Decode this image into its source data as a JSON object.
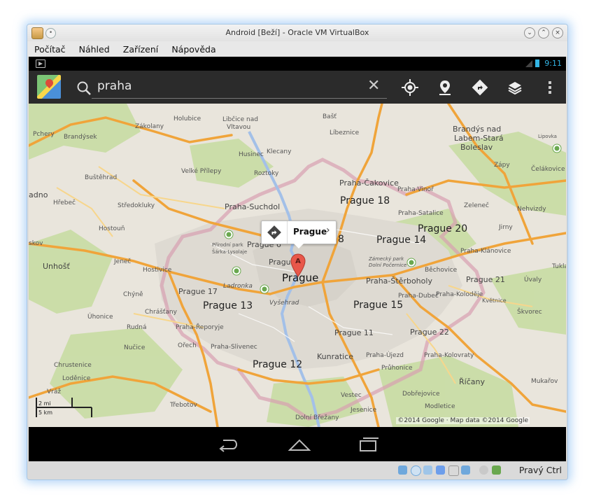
{
  "window": {
    "title": "Android [Beží] - Oracle VM VirtualBox",
    "menu": [
      "Počítač",
      "Náhled",
      "Zařízení",
      "Nápověda"
    ]
  },
  "android": {
    "status_time": "9:11",
    "search": {
      "value": "praha"
    }
  },
  "map": {
    "popup_title": "Prague",
    "marker_letter": "A",
    "scale_mi": "2 mi",
    "scale_km": "5 km",
    "copyright": "©2014 Google · Map data ©2014 Google",
    "labels": {
      "pchery": "Pchery",
      "brandysek": "Brandýsek",
      "zakolany": "Zákolany",
      "holubice": "Holubice",
      "libcice": "Libčice nad",
      "vltavou": "Vltavou",
      "basť": "Bašť",
      "libeznice": "Líbeznice",
      "brandys1": "Brandýs nad",
      "brandys2": "Labem-Stará",
      "brandys3": "Boleslav",
      "lipovka": "Lipovka",
      "husinec": "Husinec",
      "klecany": "Klecany",
      "zapy": "Zápy",
      "celakovice": "Čelákovice",
      "velke": "Velké Přílepy",
      "roztoky": "Roztoky",
      "bustehrad": "Buštěhrad",
      "cakovice": "Praha-Čakovice",
      "vinor": "Praha-Vinoř",
      "kladno": "adno",
      "hrebec": "Hřebeč",
      "stredokluky": "Středokluky",
      "suchdol": "Praha-Suchdol",
      "p18": "Prague 18",
      "satalice": "Praha-Satalice",
      "zelenec": "Zeleneč",
      "nehvizdy": "Nehvizdy",
      "hostoun": "Hostouň",
      "p20": "Prague 20",
      "jirny": "Jirny",
      "skov": "skov",
      "prirodni1": "Přírodní park",
      "prirodni2": "Šárka-Lysolaje",
      "p6": "Prague 6",
      "p8": "8",
      "p14": "Prague 14",
      "klanovice": "Praha-Klánovice",
      "unhost": "Unhošť",
      "jenec": "Jeneč",
      "hostivice": "Hostivice",
      "pr": "Prague",
      "zamecky1": "Zámecký park",
      "zamecky2": "Dolní Počernice",
      "bechovice": "Běchovice",
      "tuklaty": "Tukla",
      "prague": "Prague",
      "sterboholy": "Praha-Štěrboholy",
      "p21": "Prague 21",
      "uvaly": "Úvaly",
      "chyne": "Chýně",
      "p17": "Prague 17",
      "ladronka": "Ladronka",
      "dubec": "Praha-Dubeč",
      "kolodeje": "Praha-Koloděje",
      "kvetnice": "Květnice",
      "uhonice": "Úhonice",
      "chrastany": "Chrášťany",
      "p13": "Prague 13",
      "vysehrad": "Vyšehrad",
      "p15": "Prague 15",
      "skvorec": "Škvorec",
      "rudna": "Rudná",
      "reporyje": "Praha-Řeporyje",
      "p11": "Prague 11",
      "p22": "Prague 22",
      "nucice": "Nučice",
      "orech": "Ořech",
      "slivenec": "Praha-Slivenec",
      "kunratice": "Kunratice",
      "ujezd": "Praha-Újezd",
      "kolovraty": "Praha-Kolovraty",
      "chrustenice": "Chrustenice",
      "p12": "Prague 12",
      "pruhonice": "Průhonice",
      "lodenice": "Loděnice",
      "ricany": "Říčany",
      "mukarov": "Mukařov",
      "vraz": "Vráž",
      "vestec": "Vestec",
      "dobrejovice": "Dobřejovice",
      "trebotov": "Třebotov",
      "jesenice": "Jesenice",
      "modletice": "Modletice",
      "brezany": "Dolní Břežany"
    }
  },
  "vbox_status": {
    "host_key": "Pravý Ctrl"
  }
}
